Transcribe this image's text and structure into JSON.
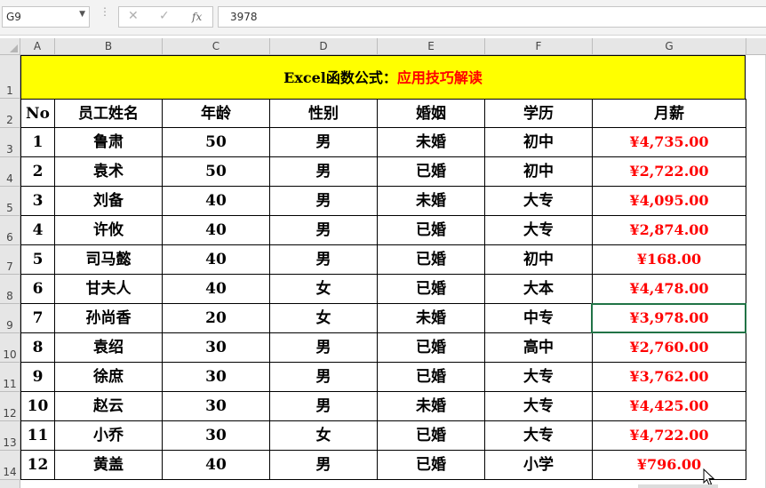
{
  "formula_bar": {
    "name_box": "G9",
    "cancel_icon": "✕",
    "enter_icon": "✓",
    "function_label": "fx",
    "formula_value": "3978"
  },
  "columns": [
    "A",
    "B",
    "C",
    "D",
    "E",
    "F",
    "G"
  ],
  "rows": [
    "1",
    "2",
    "3",
    "4",
    "5",
    "6",
    "7",
    "8",
    "9",
    "10",
    "11",
    "12",
    "13",
    "14"
  ],
  "title": {
    "black": "Excel函数公式：",
    "red": "应用技巧解读"
  },
  "headers": [
    "No",
    "员工姓名",
    "年龄",
    "性别",
    "婚姻",
    "学历",
    "月薪"
  ],
  "records": [
    [
      "1",
      "鲁肃",
      "50",
      "男",
      "未婚",
      "初中",
      "¥4,735.00"
    ],
    [
      "2",
      "袁术",
      "50",
      "男",
      "已婚",
      "初中",
      "¥2,722.00"
    ],
    [
      "3",
      "刘备",
      "40",
      "男",
      "未婚",
      "大专",
      "¥4,095.00"
    ],
    [
      "4",
      "许攸",
      "40",
      "男",
      "已婚",
      "大专",
      "¥2,874.00"
    ],
    [
      "5",
      "司马懿",
      "40",
      "男",
      "已婚",
      "初中",
      "¥168.00"
    ],
    [
      "6",
      "甘夫人",
      "40",
      "女",
      "已婚",
      "大本",
      "¥4,478.00"
    ],
    [
      "7",
      "孙尚香",
      "20",
      "女",
      "未婚",
      "中专",
      "¥3,978.00"
    ],
    [
      "8",
      "袁绍",
      "30",
      "男",
      "已婚",
      "高中",
      "¥2,760.00"
    ],
    [
      "9",
      "徐庶",
      "30",
      "男",
      "已婚",
      "大专",
      "¥3,762.00"
    ],
    [
      "10",
      "赵云",
      "30",
      "男",
      "未婚",
      "大专",
      "¥4,425.00"
    ],
    [
      "11",
      "小乔",
      "30",
      "女",
      "已婚",
      "大专",
      "¥4,722.00"
    ],
    [
      "12",
      "黄盖",
      "40",
      "男",
      "已婚",
      "小学",
      "¥796.00"
    ]
  ],
  "selected_cell": "G9",
  "colors": {
    "title_fill": "#ffff00",
    "salary_text": "#ff0000",
    "selection": "#217346"
  }
}
